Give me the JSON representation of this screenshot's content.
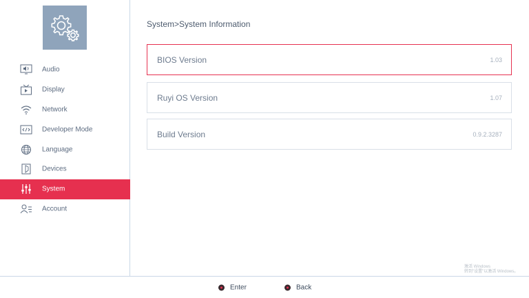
{
  "sidebar": {
    "items": [
      {
        "label": "Audio",
        "icon": "audio-icon",
        "active": false
      },
      {
        "label": "Display",
        "icon": "display-icon",
        "active": false
      },
      {
        "label": "Network",
        "icon": "wifi-icon",
        "active": false
      },
      {
        "label": "Developer Mode",
        "icon": "code-icon",
        "active": false
      },
      {
        "label": "Language",
        "icon": "globe-icon",
        "active": false
      },
      {
        "label": "Devices",
        "icon": "device-icon",
        "active": false
      },
      {
        "label": "System",
        "icon": "sliders-icon",
        "active": true
      },
      {
        "label": "Account",
        "icon": "account-icon",
        "active": false
      }
    ]
  },
  "main": {
    "breadcrumb": "System>System Information",
    "rows": [
      {
        "label": "BIOS Version",
        "value": "1.03",
        "selected": true
      },
      {
        "label": "Ruyi OS Version",
        "value": "1.07",
        "selected": false
      },
      {
        "label": "Build Version",
        "value": "0.9.2.3287",
        "selected": false
      }
    ]
  },
  "watermark": {
    "line1": "激活 Windows",
    "line2": "转到\"设置\"以激活 Windows。"
  },
  "footer": {
    "enter_label": "Enter",
    "back_label": "Back"
  },
  "colors": {
    "accent": "#e6304f",
    "logo_tile": "#8fa4bb",
    "text": "#5c6b80",
    "border": "#c9d7e6"
  }
}
